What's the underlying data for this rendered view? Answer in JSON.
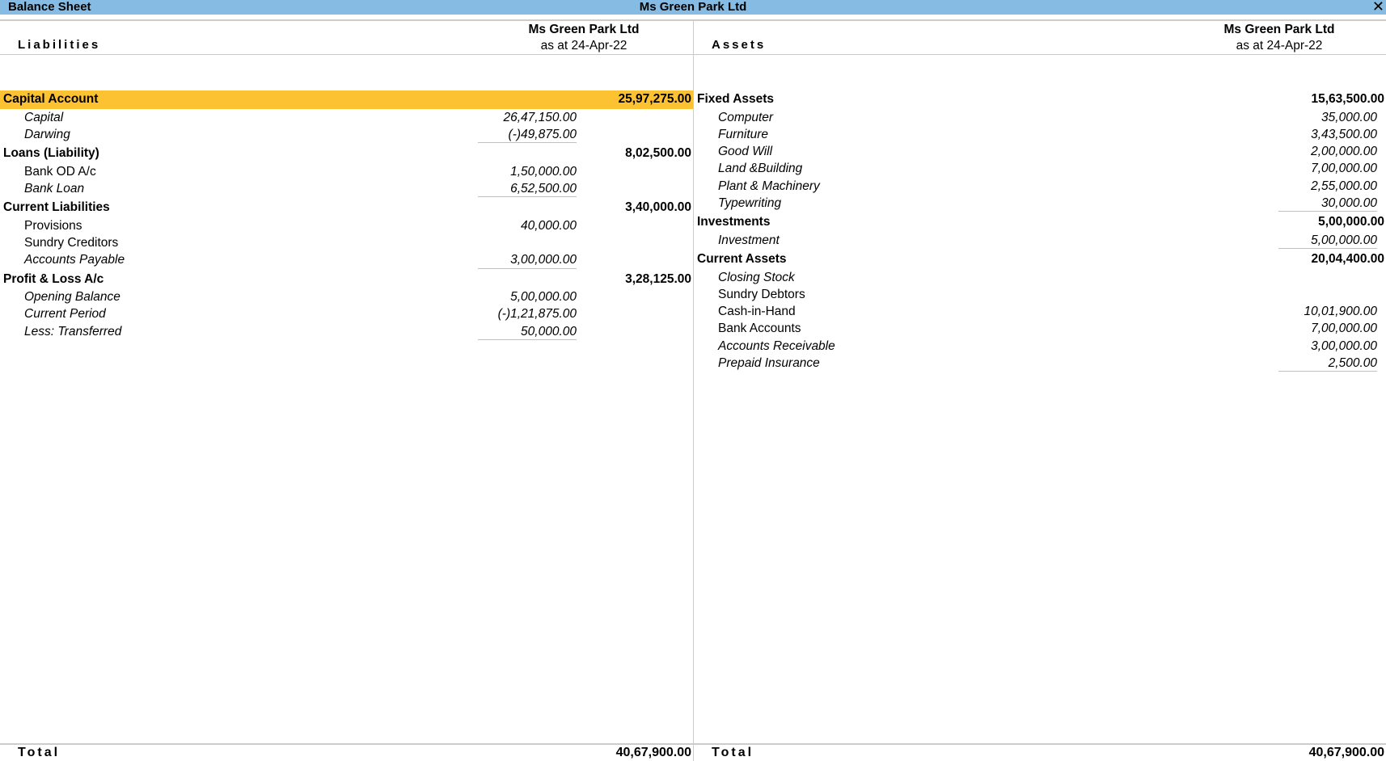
{
  "window": {
    "title": "Balance Sheet",
    "company_title": "Ms Green Park Ltd",
    "close_icon": "close-icon"
  },
  "colors": {
    "titlebar": "#86bce4",
    "selection": "#fdc232"
  },
  "liabilities": {
    "heading": "Liabilities",
    "company": "Ms Green Park Ltd",
    "as_at": "as at 24-Apr-22",
    "groups": [
      {
        "name": "Capital Account",
        "amount": "25,97,275.00",
        "selected": true,
        "items": [
          {
            "name": "Capital",
            "amount": "26,47,150.00",
            "italic": true
          },
          {
            "name": "Darwing",
            "amount": "(-)49,875.00",
            "italic": true
          }
        ]
      },
      {
        "name": "Loans (Liability)",
        "amount": "8,02,500.00",
        "items": [
          {
            "name": "Bank OD A/c",
            "amount": "1,50,000.00",
            "italic": false
          },
          {
            "name": "Bank Loan",
            "amount": "6,52,500.00",
            "italic": true
          }
        ]
      },
      {
        "name": "Current Liabilities",
        "amount": "3,40,000.00",
        "items": [
          {
            "name": "Provisions",
            "amount": "40,000.00",
            "italic": false
          },
          {
            "name": "Sundry Creditors",
            "amount": "",
            "italic": false
          },
          {
            "name": "Accounts Payable",
            "amount": "3,00,000.00",
            "italic": true
          }
        ]
      },
      {
        "name": "Profit & Loss A/c",
        "amount": "3,28,125.00",
        "items": [
          {
            "name": "Opening Balance",
            "amount": "5,00,000.00",
            "italic": true
          },
          {
            "name": "Current Period",
            "amount": "(-)1,21,875.00",
            "italic": true
          },
          {
            "name": "Less: Transferred",
            "amount": "50,000.00",
            "italic": true
          }
        ]
      }
    ],
    "total_label": "Total",
    "total": "40,67,900.00"
  },
  "assets": {
    "heading": "Assets",
    "company": "Ms Green Park Ltd",
    "as_at": "as at 24-Apr-22",
    "groups": [
      {
        "name": "Fixed Assets",
        "amount": "15,63,500.00",
        "items": [
          {
            "name": "Computer",
            "amount": "35,000.00",
            "italic": true
          },
          {
            "name": "Furniture",
            "amount": "3,43,500.00",
            "italic": true
          },
          {
            "name": "Good Will",
            "amount": "2,00,000.00",
            "italic": true
          },
          {
            "name": "Land &Building",
            "amount": "7,00,000.00",
            "italic": true
          },
          {
            "name": "Plant & Machinery",
            "amount": "2,55,000.00",
            "italic": true
          },
          {
            "name": "Typewriting",
            "amount": "30,000.00",
            "italic": true
          }
        ]
      },
      {
        "name": "Investments",
        "amount": "5,00,000.00",
        "items": [
          {
            "name": "Investment",
            "amount": "5,00,000.00",
            "italic": true
          }
        ]
      },
      {
        "name": "Current Assets",
        "amount": "20,04,400.00",
        "items": [
          {
            "name": "Closing Stock",
            "amount": "",
            "italic": true
          },
          {
            "name": "Sundry Debtors",
            "amount": "",
            "italic": false
          },
          {
            "name": "Cash-in-Hand",
            "amount": "10,01,900.00",
            "italic": false
          },
          {
            "name": "Bank Accounts",
            "amount": "7,00,000.00",
            "italic": false
          },
          {
            "name": "Accounts Receivable",
            "amount": "3,00,000.00",
            "italic": true
          },
          {
            "name": "Prepaid Insurance",
            "amount": "2,500.00",
            "italic": true
          }
        ]
      }
    ],
    "total_label": "Total",
    "total": "40,67,900.00"
  }
}
